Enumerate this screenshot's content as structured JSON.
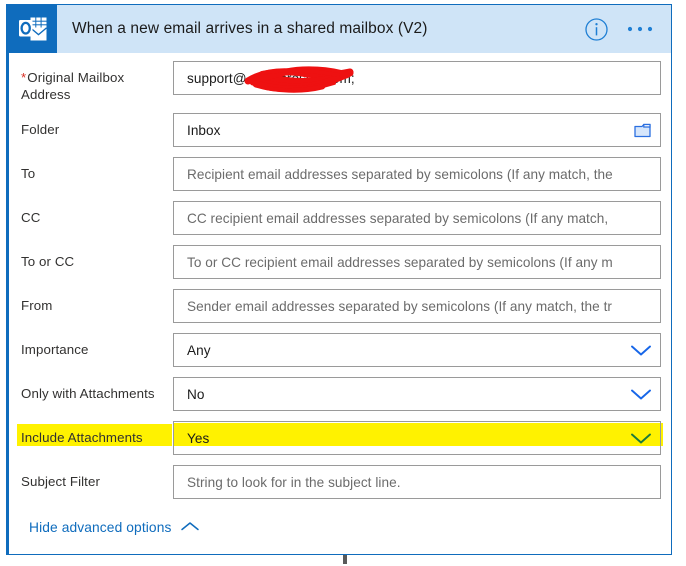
{
  "header": {
    "title": "When a new email arrives in a shared mailbox (V2)",
    "app_icon": "outlook-icon",
    "info_icon": "info-icon",
    "more_icon": "more-options-icon",
    "accent_color": "#0f6cbd",
    "band_color": "#cfe4f7"
  },
  "fields": [
    {
      "label": "Original Mailbox Address",
      "required": true,
      "value": "support@                 onmicrosoft.com;",
      "placeholder": "",
      "type": "text",
      "redacted": true,
      "trailing_icon": ""
    },
    {
      "label": "Folder",
      "required": false,
      "value": "Inbox",
      "placeholder": "",
      "type": "picker",
      "trailing_icon": "folder-icon"
    },
    {
      "label": "To",
      "required": false,
      "value": "",
      "placeholder": "Recipient email addresses separated by semicolons (If any match, the",
      "type": "text",
      "trailing_icon": ""
    },
    {
      "label": "CC",
      "required": false,
      "value": "",
      "placeholder": "CC recipient email addresses separated by semicolons (If any match,",
      "type": "text",
      "trailing_icon": ""
    },
    {
      "label": "To or CC",
      "required": false,
      "value": "",
      "placeholder": "To or CC recipient email addresses separated by semicolons (If any m",
      "type": "text",
      "trailing_icon": ""
    },
    {
      "label": "From",
      "required": false,
      "value": "",
      "placeholder": "Sender email addresses separated by semicolons (If any match, the tr",
      "type": "text",
      "trailing_icon": ""
    },
    {
      "label": "Importance",
      "required": false,
      "value": "Any",
      "placeholder": "",
      "type": "dropdown",
      "trailing_icon": "chevron-down-icon"
    },
    {
      "label": "Only with Attachments",
      "required": false,
      "value": "No",
      "placeholder": "",
      "type": "dropdown",
      "trailing_icon": "chevron-down-icon"
    },
    {
      "label": "Include Attachments",
      "required": false,
      "value": "Yes",
      "placeholder": "",
      "type": "dropdown",
      "trailing_icon": "chevron-down-icon",
      "highlighted": true,
      "highlight_color": "#fff200"
    },
    {
      "label": "Subject Filter",
      "required": false,
      "value": "",
      "placeholder": "String to look for in the subject line.",
      "type": "text",
      "trailing_icon": ""
    }
  ],
  "footer": {
    "hide_advanced_label": "Hide advanced options",
    "chevron_icon": "chevron-up-icon",
    "link_color": "#0f6cbd"
  },
  "annotations": {
    "redaction_color": "#ee1111",
    "highlight_color": "#fff200"
  }
}
